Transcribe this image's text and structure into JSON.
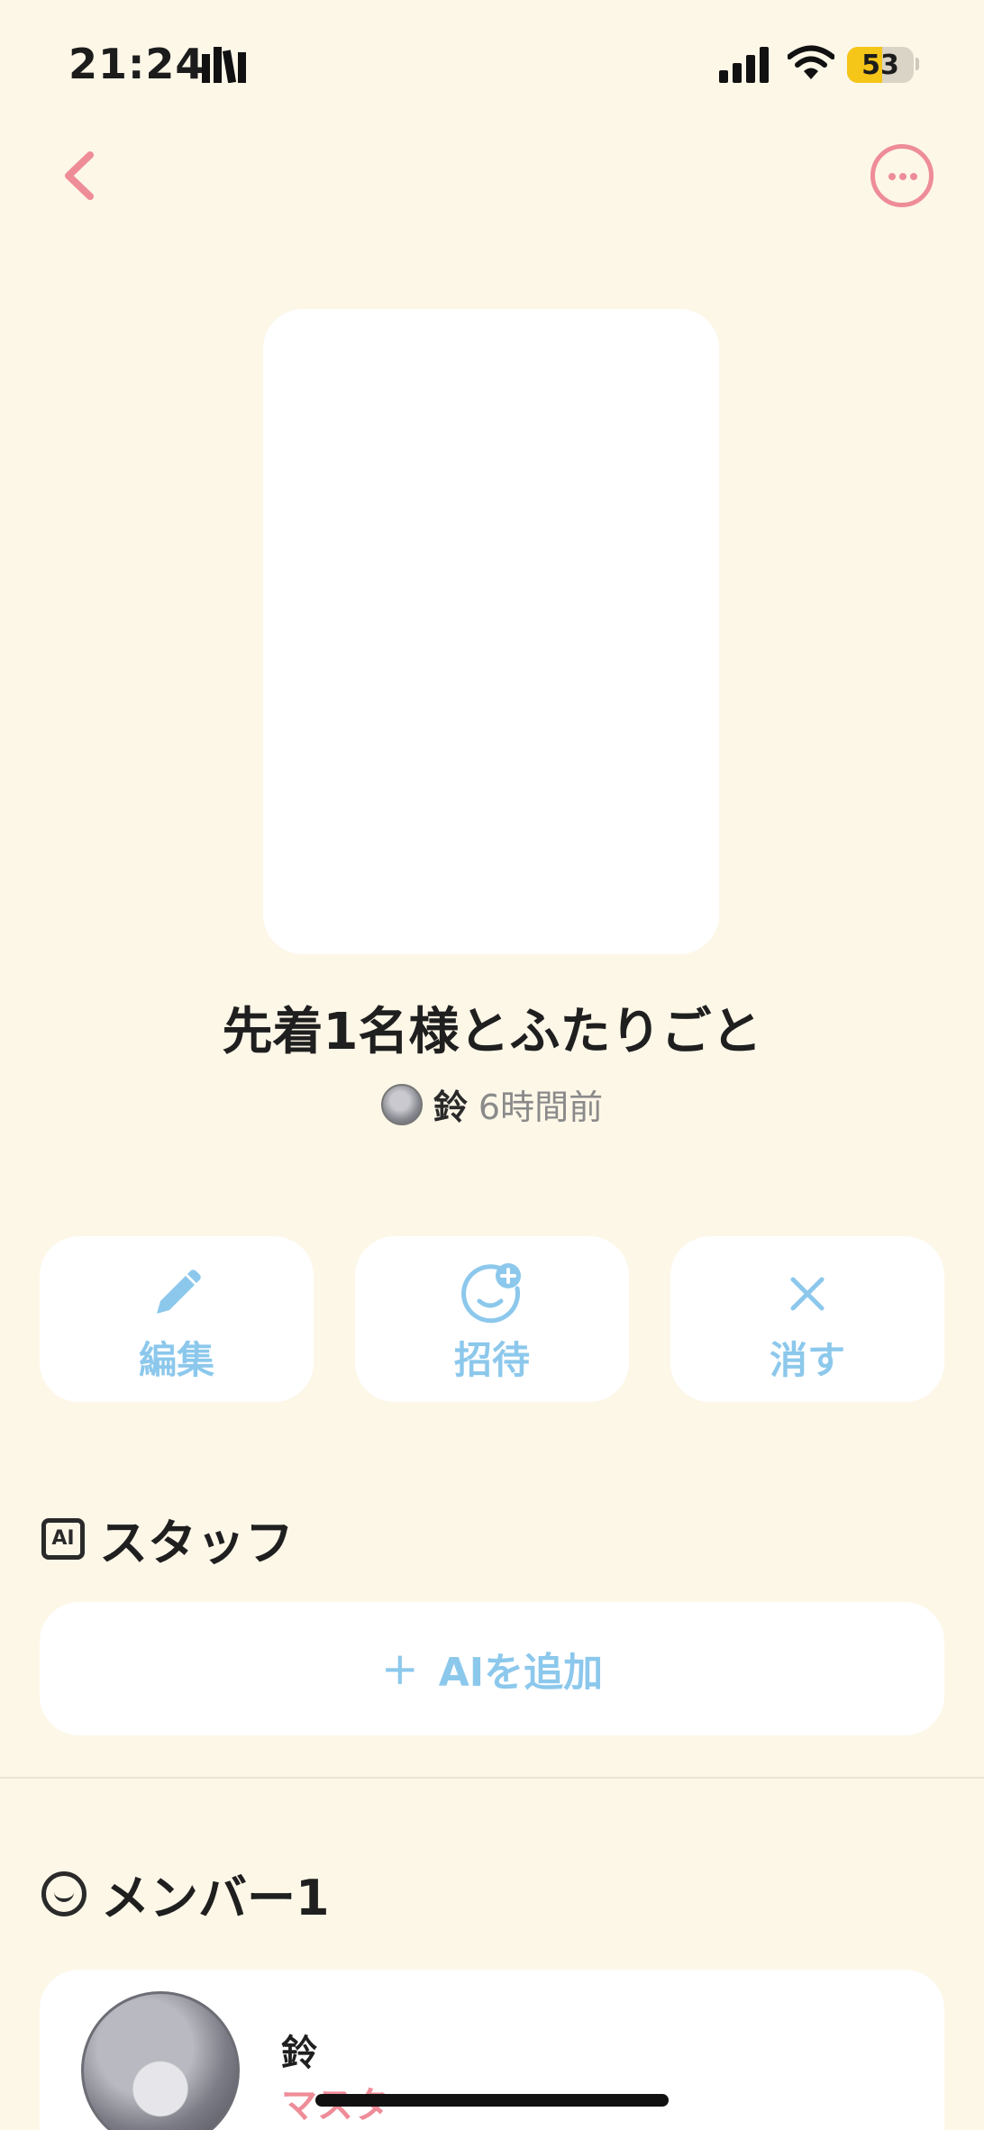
{
  "status_bar": {
    "time": "21:24",
    "battery_level": "53",
    "battery_percent": 53
  },
  "nav": {
    "back_icon": "chevron-left-icon",
    "more_icon": "ellipsis-circle-icon"
  },
  "post": {
    "title": "先着1名様とふたりごと",
    "author": "鈴",
    "time_ago": "6時間前"
  },
  "actions": [
    {
      "label": "編集",
      "icon": "pencil-icon"
    },
    {
      "label": "招待",
      "icon": "invite-smile-plus-icon"
    },
    {
      "label": "消す",
      "icon": "close-icon"
    }
  ],
  "staff_section": {
    "badge": "AI",
    "title": "スタッフ",
    "add_button_label": "AIを追加",
    "add_icon": "plus-icon"
  },
  "members_section": {
    "title": "メンバー1",
    "members": [
      {
        "name": "鈴",
        "role": "マスター"
      }
    ]
  },
  "colors": {
    "background": "#FDF7E8",
    "card": "#FFFFFF",
    "accent_pink": "#EE8C98",
    "accent_blue": "#8CC8EC",
    "battery_yellow": "#F5C518"
  }
}
